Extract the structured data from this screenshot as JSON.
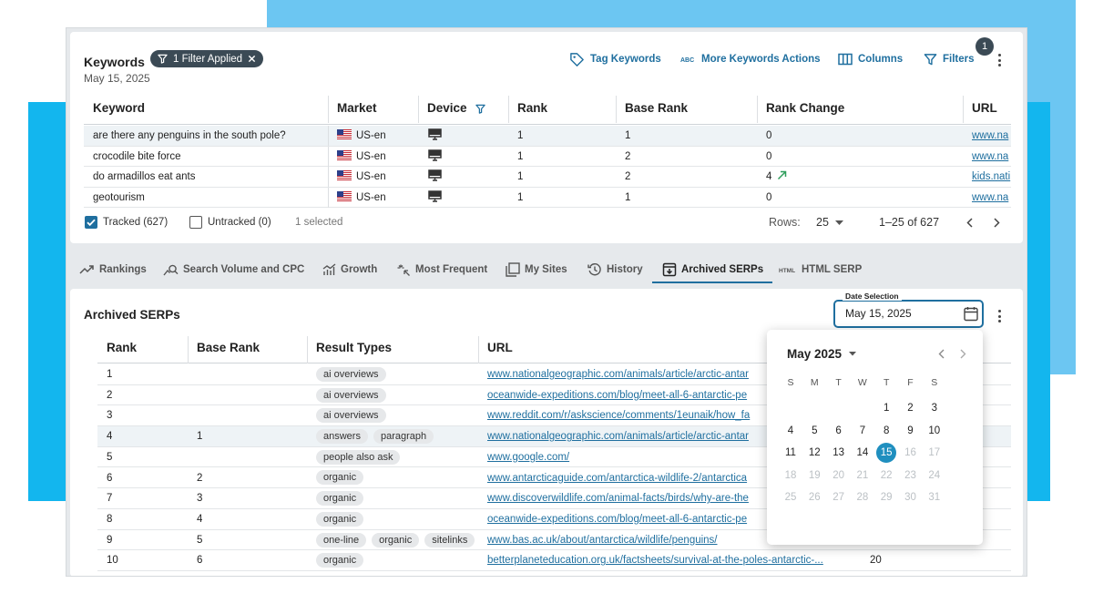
{
  "colors": {
    "accent": "#1f6f9f",
    "selected_day": "#1f8fbf",
    "chip_bg": "#3b4a55",
    "bg_light_blue": "#6cc6f2",
    "bg_blue": "#13b6ee",
    "trend_up": "#2e9e5b"
  },
  "keywords_panel": {
    "title": "Keywords",
    "date": "May 15, 2025",
    "filter_chip": "1 Filter Applied",
    "actions": {
      "tag_keywords": "Tag Keywords",
      "more_actions": "More Keywords Actions",
      "columns": "Columns",
      "filters": "Filters",
      "filters_badge": "1"
    },
    "columns": [
      "Keyword",
      "Market",
      "Device",
      "Rank",
      "Base Rank",
      "Rank Change",
      "URL"
    ],
    "rows": [
      {
        "keyword": "are there any penguins in the south pole?",
        "market": "US-en",
        "device": "desktop-icon",
        "rank": "1",
        "base_rank": "1",
        "rank_change": "0",
        "url": "www.na",
        "trend": ""
      },
      {
        "keyword": "crocodile bite force",
        "market": "US-en",
        "device": "desktop-icon",
        "rank": "1",
        "base_rank": "2",
        "rank_change": "0",
        "url": "www.na",
        "trend": ""
      },
      {
        "keyword": "do armadillos eat ants",
        "market": "US-en",
        "device": "desktop-icon",
        "rank": "1",
        "base_rank": "2",
        "rank_change": "4",
        "url": "kids.nati",
        "trend": "up"
      },
      {
        "keyword": "geotourism",
        "market": "US-en",
        "device": "desktop-icon",
        "rank": "1",
        "base_rank": "1",
        "rank_change": "0",
        "url": "www.na",
        "trend": ""
      }
    ],
    "footer": {
      "tracked": "Tracked (627)",
      "untracked": "Untracked (0)",
      "selected": "1 selected",
      "rows_label": "Rows:",
      "rows_value": "25",
      "range": "1–25 of 627"
    }
  },
  "tabs": [
    {
      "label": "Rankings",
      "icon": "trend-icon"
    },
    {
      "label": "Search Volume and CPC",
      "icon": "search-volume-icon"
    },
    {
      "label": "Growth",
      "icon": "growth-icon"
    },
    {
      "label": "Most Frequent",
      "icon": "sparkle-icon"
    },
    {
      "label": "My Sites",
      "icon": "sites-icon"
    },
    {
      "label": "History",
      "icon": "history-icon"
    },
    {
      "label": "Archived SERPs",
      "icon": "archive-icon",
      "active": true
    },
    {
      "label": "HTML SERP",
      "icon": "html-icon"
    }
  ],
  "archived_panel": {
    "title": "Archived SERPs",
    "date_selection_label": "Date Selection",
    "date_value": "May 15, 2025",
    "columns": [
      "Rank",
      "Base Rank",
      "Result Types",
      "URL"
    ],
    "rows": [
      {
        "rank": "1",
        "base_rank": "",
        "types": [
          "ai overviews"
        ],
        "url": "www.nationalgeographic.com/animals/article/arctic-antar",
        "extra": ""
      },
      {
        "rank": "2",
        "base_rank": "",
        "types": [
          "ai overviews"
        ],
        "url": "oceanwide-expeditions.com/blog/meet-all-6-antarctic-pe",
        "extra": ""
      },
      {
        "rank": "3",
        "base_rank": "",
        "types": [
          "ai overviews"
        ],
        "url": "www.reddit.com/r/askscience/comments/1eunaik/how_fa",
        "extra": ""
      },
      {
        "rank": "4",
        "base_rank": "1",
        "types": [
          "answers",
          "paragraph"
        ],
        "url": "www.nationalgeographic.com/animals/article/arctic-antar",
        "extra": ""
      },
      {
        "rank": "5",
        "base_rank": "",
        "types": [
          "people also ask"
        ],
        "url": "www.google.com/",
        "extra": ""
      },
      {
        "rank": "6",
        "base_rank": "2",
        "types": [
          "organic"
        ],
        "url": "www.antarcticaguide.com/antarctica-wildlife-2/antarctica",
        "extra": ""
      },
      {
        "rank": "7",
        "base_rank": "3",
        "types": [
          "organic"
        ],
        "url": "www.discoverwildlife.com/animal-facts/birds/why-are-the",
        "extra": ""
      },
      {
        "rank": "8",
        "base_rank": "4",
        "types": [
          "organic"
        ],
        "url": "oceanwide-expeditions.com/blog/meet-all-6-antarctic-pe",
        "extra": ""
      },
      {
        "rank": "9",
        "base_rank": "5",
        "types": [
          "one-line",
          "organic",
          "sitelinks"
        ],
        "url": "www.bas.ac.uk/about/antarctica/wildlife/penguins/",
        "extra": ""
      },
      {
        "rank": "10",
        "base_rank": "6",
        "types": [
          "organic"
        ],
        "url": "betterplaneteducation.org.uk/factsheets/survival-at-the-poles-antarctic-...",
        "extra": "20"
      }
    ]
  },
  "calendar": {
    "month_label": "May 2025",
    "weekdays": [
      "S",
      "M",
      "T",
      "W",
      "T",
      "F",
      "S"
    ],
    "first_weekday": 4,
    "days_in_month": 31,
    "selected_day": 15,
    "last_enabled_day": 15
  }
}
